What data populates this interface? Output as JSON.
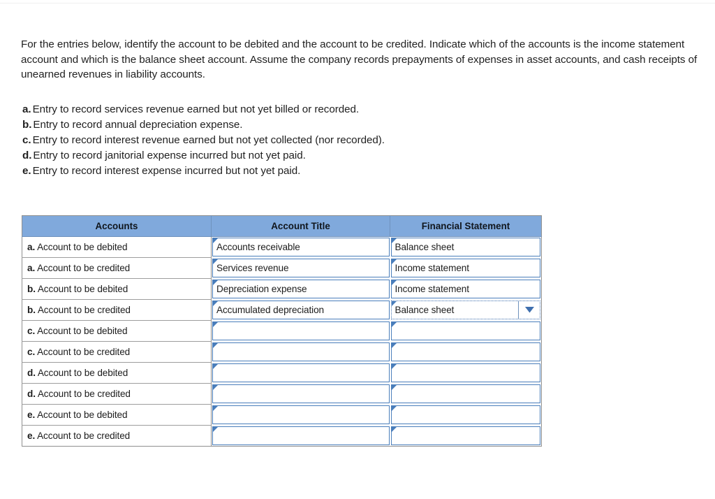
{
  "question": {
    "intro": "For the entries below, identify the account to be debited and the account to be credited. Indicate which of the accounts is the income statement account and which is the balance sheet account. Assume the company records prepayments of expenses in asset accounts, and cash receipts of unearned revenues in liability accounts.",
    "entries": [
      {
        "letter": "a.",
        "text": "Entry to record services revenue earned but not yet billed or recorded."
      },
      {
        "letter": "b.",
        "text": "Entry to record annual depreciation expense."
      },
      {
        "letter": "c.",
        "text": "Entry to record interest revenue earned but not yet collected (nor recorded)."
      },
      {
        "letter": "d.",
        "text": "Entry to record janitorial expense incurred but not yet paid."
      },
      {
        "letter": "e.",
        "text": "Entry to record interest expense incurred but not yet paid."
      }
    ]
  },
  "table": {
    "headers": [
      "Accounts",
      "Account Title",
      "Financial Statement"
    ],
    "rows": [
      {
        "letter": "a.",
        "label": "Account to be debited",
        "account_title": "Accounts receivable",
        "financial_statement": "Balance sheet",
        "focused": false
      },
      {
        "letter": "a.",
        "label": "Account to be credited",
        "account_title": "Services revenue",
        "financial_statement": "Income statement",
        "focused": false
      },
      {
        "letter": "b.",
        "label": "Account to be debited",
        "account_title": "Depreciation expense",
        "financial_statement": "Income statement",
        "focused": false
      },
      {
        "letter": "b.",
        "label": "Account to be credited",
        "account_title": "Accumulated depreciation",
        "financial_statement": "Balance sheet",
        "focused": true
      },
      {
        "letter": "c.",
        "label": "Account to be debited",
        "account_title": "",
        "financial_statement": "",
        "focused": false
      },
      {
        "letter": "c.",
        "label": "Account to be credited",
        "account_title": "",
        "financial_statement": "",
        "focused": false
      },
      {
        "letter": "d.",
        "label": "Account to be debited",
        "account_title": "",
        "financial_statement": "",
        "focused": false
      },
      {
        "letter": "d.",
        "label": "Account to be credited",
        "account_title": "",
        "financial_statement": "",
        "focused": false
      },
      {
        "letter": "e.",
        "label": "Account to be debited",
        "account_title": "",
        "financial_statement": "",
        "focused": false
      },
      {
        "letter": "e.",
        "label": "Account to be credited",
        "account_title": "",
        "financial_statement": "",
        "focused": false
      }
    ]
  },
  "colors": {
    "header_blue": "#80a9dc",
    "field_border_blue": "#4a7ebb",
    "table_border_gray": "#8f8f8f",
    "text": "#1d1d1d"
  },
  "icons": {
    "dropdown_arrow": "chevron-down-icon"
  }
}
